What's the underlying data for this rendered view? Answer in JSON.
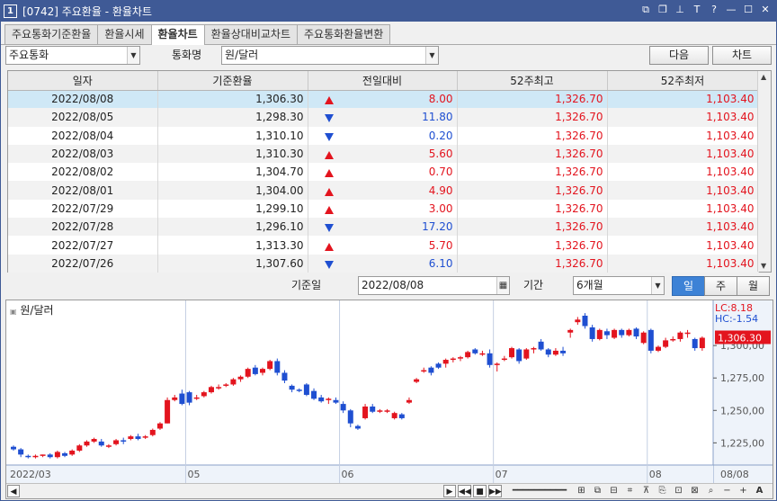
{
  "window": {
    "number": "1",
    "title": "[0742] 주요환율 - 환율차트"
  },
  "tabs": [
    {
      "label": "주요통화기준환율",
      "active": false
    },
    {
      "label": "환율시세",
      "active": false
    },
    {
      "label": "환율차트",
      "active": true
    },
    {
      "label": "환율상대비교차트",
      "active": false
    },
    {
      "label": "주요통화환율변환",
      "active": false
    }
  ],
  "toolbar": {
    "group_value": "주요통화",
    "currency_label": "통화명",
    "currency_value": "원/달러",
    "next_button": "다음",
    "chart_button": "차트"
  },
  "table": {
    "headers": [
      "일자",
      "기준환율",
      "전일대비",
      "52주최고",
      "52주최저"
    ],
    "rows": [
      {
        "date": "2022/08/08",
        "rate": "1,306.30",
        "dir": "up",
        "change": "8.00",
        "high": "1,326.70",
        "low": "1,103.40"
      },
      {
        "date": "2022/08/05",
        "rate": "1,298.30",
        "dir": "down",
        "change": "11.80",
        "high": "1,326.70",
        "low": "1,103.40"
      },
      {
        "date": "2022/08/04",
        "rate": "1,310.10",
        "dir": "down",
        "change": "0.20",
        "high": "1,326.70",
        "low": "1,103.40"
      },
      {
        "date": "2022/08/03",
        "rate": "1,310.30",
        "dir": "up",
        "change": "5.60",
        "high": "1,326.70",
        "low": "1,103.40"
      },
      {
        "date": "2022/08/02",
        "rate": "1,304.70",
        "dir": "up",
        "change": "0.70",
        "high": "1,326.70",
        "low": "1,103.40"
      },
      {
        "date": "2022/08/01",
        "rate": "1,304.00",
        "dir": "up",
        "change": "4.90",
        "high": "1,326.70",
        "low": "1,103.40"
      },
      {
        "date": "2022/07/29",
        "rate": "1,299.10",
        "dir": "up",
        "change": "3.00",
        "high": "1,326.70",
        "low": "1,103.40"
      },
      {
        "date": "2022/07/28",
        "rate": "1,296.10",
        "dir": "down",
        "change": "17.20",
        "high": "1,326.70",
        "low": "1,103.40"
      },
      {
        "date": "2022/07/27",
        "rate": "1,313.30",
        "dir": "up",
        "change": "5.70",
        "high": "1,326.70",
        "low": "1,103.40"
      },
      {
        "date": "2022/07/26",
        "rate": "1,307.60",
        "dir": "down",
        "change": "6.10",
        "high": "1,326.70",
        "low": "1,103.40"
      }
    ]
  },
  "datebar": {
    "base_date_label": "기준일",
    "base_date_value": "2022/08/08",
    "period_label": "기간",
    "period_value": "6개월",
    "period_buttons": [
      {
        "label": "일",
        "active": true
      },
      {
        "label": "주",
        "active": false
      },
      {
        "label": "월",
        "active": false
      }
    ]
  },
  "colors": {
    "up": "#e3141e",
    "down": "#1f4fd1",
    "title_bar": "#3f5a96",
    "active_button": "#3d82d6"
  },
  "chart_data": {
    "type": "candlestick",
    "title": "원/달러",
    "lc_label": "LC:8.18",
    "hc_label": "HC:-1.54",
    "last_price_label": "1,306.30",
    "ylim": [
      1210,
      1332
    ],
    "y_ticks": [
      {
        "value": 1300,
        "label": "1,300,00"
      },
      {
        "value": 1275,
        "label": "1,275,00"
      },
      {
        "value": 1250,
        "label": "1,250,00"
      },
      {
        "value": 1225,
        "label": "1,225,00"
      }
    ],
    "x_ticks": [
      {
        "index": 0,
        "label": "2022/03"
      },
      {
        "index": 24,
        "label": "05"
      },
      {
        "index": 45,
        "label": "06"
      },
      {
        "index": 66,
        "label": "07"
      },
      {
        "index": 87,
        "label": "08"
      }
    ],
    "x_last_label": "08/08",
    "candles": [
      [
        1222,
        1223,
        1219,
        1220
      ],
      [
        1220,
        1221,
        1214,
        1216
      ],
      [
        1215,
        1216,
        1213,
        1214
      ],
      [
        1214,
        1216,
        1213,
        1215
      ],
      [
        1215,
        1216,
        1214,
        1216
      ],
      [
        1216,
        1217,
        1213,
        1214
      ],
      [
        1214,
        1219,
        1213,
        1218
      ],
      [
        1217,
        1218,
        1214,
        1215
      ],
      [
        1216,
        1220,
        1215,
        1219
      ],
      [
        1219,
        1224,
        1218,
        1223
      ],
      [
        1223,
        1227,
        1222,
        1226
      ],
      [
        1226,
        1229,
        1225,
        1228
      ],
      [
        1226,
        1228,
        1222,
        1223
      ],
      [
        1222,
        1224,
        1221,
        1223
      ],
      [
        1224,
        1228,
        1223,
        1227
      ],
      [
        1227,
        1229,
        1224,
        1226
      ],
      [
        1228,
        1231,
        1227,
        1230
      ],
      [
        1230,
        1232,
        1227,
        1228
      ],
      [
        1229,
        1231,
        1228,
        1230
      ],
      [
        1231,
        1236,
        1230,
        1235
      ],
      [
        1236,
        1241,
        1235,
        1240
      ],
      [
        1240,
        1260,
        1240,
        1258
      ],
      [
        1258,
        1262,
        1257,
        1260
      ],
      [
        1263,
        1266,
        1254,
        1255
      ],
      [
        1264,
        1265,
        1254,
        1256
      ],
      [
        1260,
        1262,
        1258,
        1260
      ],
      [
        1261,
        1265,
        1260,
        1264
      ],
      [
        1264,
        1269,
        1263,
        1268
      ],
      [
        1268,
        1270,
        1266,
        1268
      ],
      [
        1270,
        1271,
        1268,
        1270
      ],
      [
        1270,
        1275,
        1269,
        1274
      ],
      [
        1274,
        1277,
        1272,
        1276
      ],
      [
        1276,
        1283,
        1275,
        1282
      ],
      [
        1283,
        1285,
        1277,
        1278
      ],
      [
        1279,
        1283,
        1277,
        1282
      ],
      [
        1282,
        1289,
        1281,
        1288
      ],
      [
        1288,
        1290,
        1277,
        1279
      ],
      [
        1279,
        1281,
        1271,
        1273
      ],
      [
        1269,
        1270,
        1264,
        1266
      ],
      [
        1266,
        1267,
        1264,
        1265
      ],
      [
        1270,
        1271,
        1261,
        1262
      ],
      [
        1265,
        1267,
        1258,
        1259
      ],
      [
        1260,
        1262,
        1256,
        1257
      ],
      [
        1259,
        1260,
        1255,
        1259
      ],
      [
        1258,
        1260,
        1255,
        1256
      ],
      [
        1255,
        1257,
        1248,
        1250
      ],
      [
        1250,
        1251,
        1237,
        1240
      ],
      [
        1238,
        1239,
        1235,
        1236
      ],
      [
        1244,
        1255,
        1243,
        1253
      ],
      [
        1253,
        1255,
        1248,
        1249
      ],
      [
        1250,
        1251,
        1248,
        1250
      ],
      [
        1249,
        1251,
        1248,
        1250
      ],
      [
        1244,
        1249,
        1243,
        1248
      ],
      [
        1247,
        1248,
        1243,
        1244
      ],
      [
        1256,
        1260,
        1255,
        1258
      ],
      [
        1272,
        1275,
        1271,
        1274
      ],
      [
        1281,
        1283,
        1279,
        1281
      ],
      [
        1283,
        1284,
        1277,
        1279
      ],
      [
        1286,
        1287,
        1282,
        1283
      ],
      [
        1286,
        1290,
        1283,
        1289
      ],
      [
        1290,
        1291,
        1287,
        1290
      ],
      [
        1291,
        1292,
        1288,
        1291
      ],
      [
        1291,
        1296,
        1290,
        1295
      ],
      [
        1297,
        1298,
        1293,
        1294
      ],
      [
        1294,
        1296,
        1292,
        1294
      ],
      [
        1294,
        1297,
        1283,
        1285
      ],
      [
        1285,
        1287,
        1280,
        1286
      ],
      [
        1289,
        1292,
        1288,
        1290
      ],
      [
        1291,
        1299,
        1290,
        1298
      ],
      [
        1297,
        1298,
        1286,
        1288
      ],
      [
        1290,
        1298,
        1289,
        1297
      ],
      [
        1297,
        1299,
        1294,
        1298
      ],
      [
        1303,
        1305,
        1296,
        1297
      ],
      [
        1297,
        1298,
        1291,
        1293
      ],
      [
        1293,
        1298,
        1292,
        1296
      ],
      [
        1296,
        1299,
        1292,
        1294
      ],
      [
        1310,
        1313,
        1306,
        1312
      ],
      [
        1318,
        1322,
        1316,
        1320
      ],
      [
        1323,
        1325,
        1313,
        1315
      ],
      [
        1314,
        1316,
        1303,
        1305
      ],
      [
        1305,
        1313,
        1304,
        1312
      ],
      [
        1311,
        1313,
        1305,
        1308
      ],
      [
        1306,
        1313,
        1305,
        1312
      ],
      [
        1312,
        1313,
        1306,
        1308
      ],
      [
        1308,
        1313,
        1307,
        1312
      ],
      [
        1313,
        1314,
        1305,
        1307
      ],
      [
        1302,
        1311,
        1301,
        1310
      ],
      [
        1312,
        1313,
        1294,
        1296
      ],
      [
        1296,
        1300,
        1295,
        1299
      ],
      [
        1299,
        1306,
        1298,
        1304
      ],
      [
        1305,
        1307,
        1303,
        1305
      ],
      [
        1305,
        1311,
        1303,
        1310
      ],
      [
        1310,
        1312,
        1306,
        1310
      ],
      [
        1305,
        1306,
        1296,
        1298
      ],
      [
        1298,
        1307,
        1296,
        1306
      ]
    ]
  }
}
